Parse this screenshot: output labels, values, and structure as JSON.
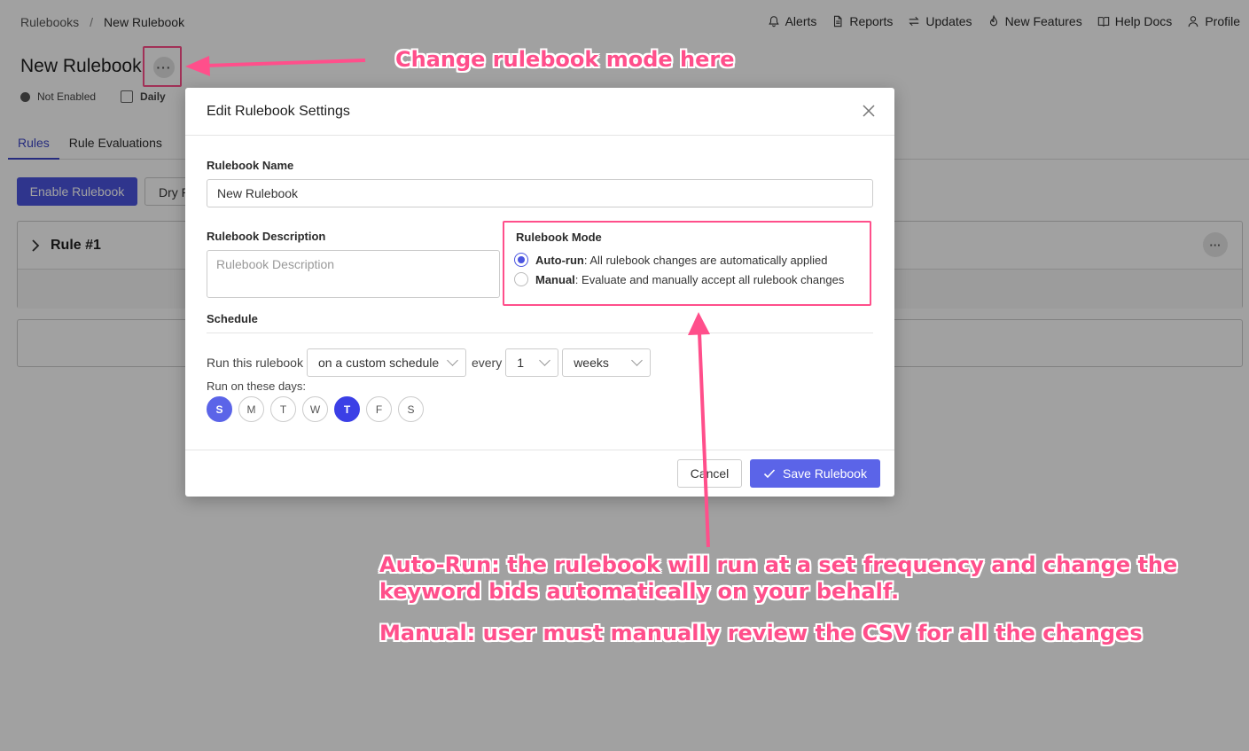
{
  "breadcrumb": {
    "root": "Rulebooks",
    "separator": "/",
    "current": "New Rulebook"
  },
  "topnav": [
    {
      "label": "Alerts",
      "icon": "bell-icon"
    },
    {
      "label": "Reports",
      "icon": "document-icon"
    },
    {
      "label": "Updates",
      "icon": "arrows-icon"
    },
    {
      "label": "New Features",
      "icon": "flame-icon"
    },
    {
      "label": "Help Docs",
      "icon": "book-icon"
    },
    {
      "label": "Profile",
      "icon": "user-icon"
    }
  ],
  "page": {
    "title": "New Rulebook",
    "more_label": "···",
    "status": "Not Enabled",
    "frequency": "Daily"
  },
  "tabs": [
    {
      "label": "Rules",
      "active": true
    },
    {
      "label": "Rule Evaluations",
      "active": false
    }
  ],
  "actions": {
    "enable": "Enable Rulebook",
    "dry_run": "Dry R"
  },
  "rule": {
    "title": "Rule #1",
    "more_label": "···"
  },
  "modal": {
    "title": "Edit Rulebook Settings",
    "name_label": "Rulebook Name",
    "name_value": "New Rulebook",
    "description_label": "Rulebook Description",
    "description_placeholder": "Rulebook Description",
    "mode_label": "Rulebook Mode",
    "modes": [
      {
        "name": "Auto-run",
        "desc": ": All rulebook changes are automatically applied",
        "checked": true
      },
      {
        "name": "Manual",
        "desc": ": Evaluate and manually accept all rulebook changes",
        "checked": false
      }
    ],
    "schedule_label": "Schedule",
    "run_prefix": "Run this rulebook",
    "schedule_type": "on a custom schedule",
    "every_label": "every",
    "interval_value": "1",
    "interval_unit": "weeks",
    "days_label": "Run on these days:",
    "days": [
      {
        "label": "S",
        "state": "selected"
      },
      {
        "label": "M",
        "state": "off"
      },
      {
        "label": "T",
        "state": "off"
      },
      {
        "label": "W",
        "state": "off"
      },
      {
        "label": "T",
        "state": "selected-strong"
      },
      {
        "label": "F",
        "state": "off"
      },
      {
        "label": "S",
        "state": "off"
      }
    ],
    "cancel_label": "Cancel",
    "save_label": "Save Rulebook"
  },
  "annotations": {
    "top": "Change rulebook mode here",
    "auto_line1": "Auto-Run: the rulebook will run at a set frequency and change the",
    "auto_line2": "keyword bids automatically on your behalf.",
    "manual": "Manual: user must manually review the CSV for all the changes"
  },
  "colors": {
    "accent": "#4b55e0",
    "annotation": "#ff4f8b",
    "selected_day": "#5b64e8",
    "selected_day_strong": "#3b3fe6"
  }
}
